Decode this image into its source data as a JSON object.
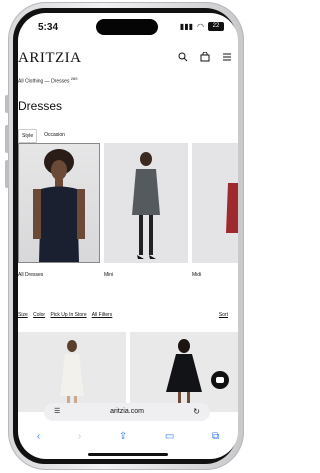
{
  "status_bar": {
    "time": "5:34",
    "battery": "22"
  },
  "header": {
    "logo": "ARITZIA"
  },
  "breadcrumb": {
    "text": "All Clothing — Dresses",
    "count": "289"
  },
  "page": {
    "title": "Dresses"
  },
  "tabs": [
    {
      "label": "Style"
    },
    {
      "label": "Occasion"
    }
  ],
  "categories": [
    {
      "label": "All Dresses"
    },
    {
      "label": "Mini"
    },
    {
      "label": "Midi"
    }
  ],
  "filters": {
    "items": [
      "Size",
      "Color",
      "Pick Up In Store",
      "All Filters"
    ],
    "sort": "Sort"
  },
  "browser": {
    "url": "aritzia.com"
  }
}
